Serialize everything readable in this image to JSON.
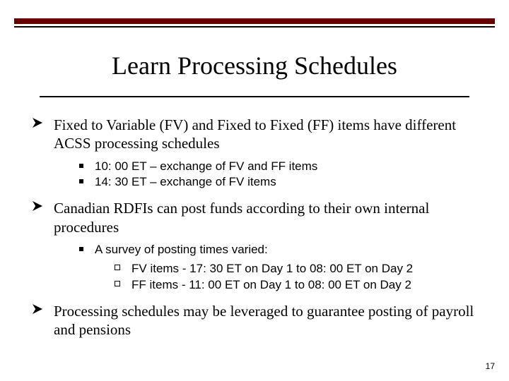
{
  "title": "Learn Processing Schedules",
  "bullets": {
    "b1": {
      "text": "Fixed to Variable (FV) and Fixed to Fixed (FF) items have different ACSS processing schedules",
      "sub": {
        "s1": "10: 00 ET – exchange of FV and FF items",
        "s2": "14: 30 ET – exchange of FV items"
      }
    },
    "b2": {
      "text": "Canadian RDFIs can post funds according to their own internal procedures",
      "sub": {
        "s1": {
          "text": "A survey of posting times varied:",
          "sub": {
            "t1": "FV items - 17: 30 ET on Day 1 to 08: 00 ET on Day 2",
            "t2": "FF items - 11: 00 ET on Day 1 to 08: 00 ET on Day 2"
          }
        }
      }
    },
    "b3": {
      "text": "Processing schedules may be leveraged to guarantee posting of payroll and pensions"
    }
  },
  "page_number": "17"
}
